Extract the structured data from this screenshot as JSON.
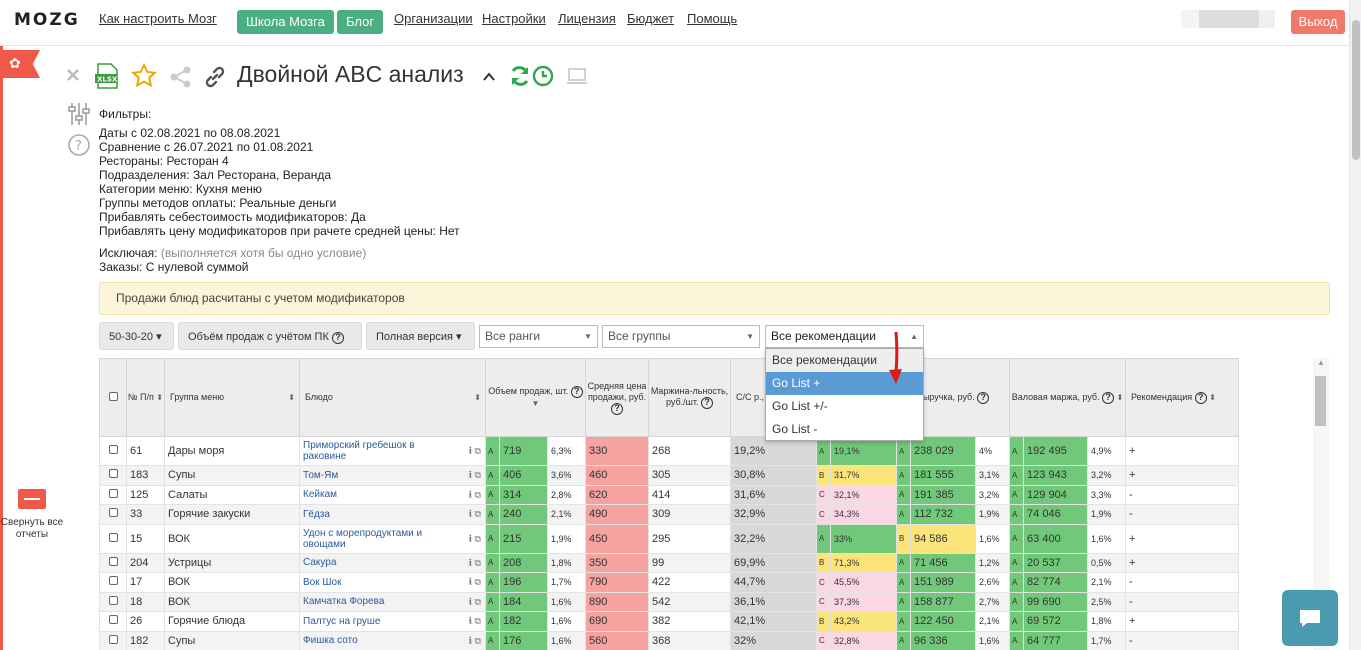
{
  "header": {
    "logo": "MOZG",
    "nav_links": {
      "howto": "Как настроить Мозг",
      "school": "Школа Мозга",
      "blog": "Блог",
      "orgs": "Организации",
      "settings": "Настройки",
      "license": "Лицензия",
      "budget": "Бюджет",
      "help": "Помощь"
    },
    "exit_label": "Выход"
  },
  "sidebar": {
    "collapse_label": "Свернуть все отчеты"
  },
  "report": {
    "title": "Двойной ABC анализ",
    "icons": [
      "close-icon",
      "xlsx-export-icon",
      "star-icon",
      "share-icon",
      "link-icon",
      "chevron-up-icon",
      "refresh-icon",
      "clock-icon",
      "monitor-icon"
    ]
  },
  "filters": {
    "heading": "Фильтры:",
    "lines": [
      "Даты с 02.08.2021 по 08.08.2021",
      "Сравнение с 26.07.2021 по 01.08.2021",
      "Рестораны: Ресторан 4",
      "Подразделения: Зал Ресторана, Веранда",
      "Категории меню: Кухня меню",
      "Группы методов оплаты: Реальные деньги",
      "Прибавлять себестоимость модификаторов: Да",
      "Прибавлять цену модификаторов при рачете средней цены: Нет"
    ],
    "exclude_label": "Исключая:",
    "exclude_hint": "(выполняется хотя бы одно условие)",
    "orders_line": "Заказы: С нулевой суммой"
  },
  "notice": "Продажи блюд расчитаны с учетом модификаторов",
  "toolbar": {
    "ratio": "50-30-20",
    "volume": "Объём продаж с учётом ПК",
    "version": "Полная версия",
    "ranks_placeholder": "Все ранги",
    "groups_placeholder": "Все группы",
    "recommend_value": "Все рекомендации"
  },
  "dropdown": {
    "options": [
      "Все рекомендации",
      "Go List +",
      "Go List +/-",
      "Go List -"
    ],
    "highlighted_index": 1
  },
  "table": {
    "headers": {
      "num": "№ П/п",
      "group": "Группа меню",
      "dish": "Блюдо",
      "volume": "Объем продаж, шт.",
      "avgprice": "Средняя цена продажи, руб.",
      "margin": "Маржина-льность, руб./шт.",
      "cc": "С/С р., %",
      "revenue": "Выручка, руб.",
      "grossmargin": "Валовая маржа, руб.",
      "recommendation": "Рекомендация"
    },
    "rows": [
      {
        "n": "61",
        "group": "Дары моря",
        "dish": "Приморский гребешок в раковине",
        "vr": "A",
        "vol": "719",
        "vp": "6,3%",
        "price": "330",
        "margin": "268",
        "cc": "19,2%",
        "cr": "A",
        "ccp": "19,1%",
        "rr": "A",
        "rev": "238 029",
        "revp": "4%",
        "mr": "A",
        "gm": "192 495",
        "gmp": "4,9%",
        "rec": "+"
      },
      {
        "n": "183",
        "group": "Супы",
        "dish": "Том-Ям",
        "vr": "A",
        "vol": "406",
        "vp": "3,6%",
        "price": "460",
        "margin": "305",
        "cc": "30,8%",
        "cr": "B",
        "ccp": "31,7%",
        "rr": "A",
        "rev": "181 555",
        "revp": "3,1%",
        "mr": "A",
        "gm": "123 943",
        "gmp": "3,2%",
        "rec": "+"
      },
      {
        "n": "125",
        "group": "Салаты",
        "dish": "Кейкам",
        "vr": "A",
        "vol": "314",
        "vp": "2,8%",
        "price": "620",
        "margin": "414",
        "cc": "31,6%",
        "cr": "C",
        "ccp": "32,1%",
        "rr": "A",
        "rev": "191 385",
        "revp": "3,2%",
        "mr": "A",
        "gm": "129 904",
        "gmp": "3,3%",
        "rec": "-"
      },
      {
        "n": "33",
        "group": "Горячие закуски",
        "dish": "Гёдза",
        "vr": "A",
        "vol": "240",
        "vp": "2,1%",
        "price": "490",
        "margin": "309",
        "cc": "32,9%",
        "cr": "C",
        "ccp": "34,3%",
        "rr": "A",
        "rev": "112 732",
        "revp": "1,9%",
        "mr": "A",
        "gm": "74 046",
        "gmp": "1,9%",
        "rec": "-"
      },
      {
        "n": "15",
        "group": "ВОК",
        "dish": "Удон с морепродуктами и овощами",
        "vr": "A",
        "vol": "215",
        "vp": "1,9%",
        "price": "450",
        "margin": "295",
        "cc": "32,2%",
        "cr": "A",
        "ccp": "33%",
        "rr": "B",
        "rev": "94 586",
        "revp": "1,6%",
        "mr": "A",
        "gm": "63 400",
        "gmp": "1,6%",
        "rec": "+"
      },
      {
        "n": "204",
        "group": "Устрицы",
        "dish": "Сакура",
        "vr": "A",
        "vol": "208",
        "vp": "1,8%",
        "price": "350",
        "margin": "99",
        "cc": "69,9%",
        "cr": "B",
        "ccp": "71,3%",
        "rr": "A",
        "rev": "71 456",
        "revp": "1,2%",
        "mr": "A",
        "gm": "20 537",
        "gmp": "0,5%",
        "rec": "+"
      },
      {
        "n": "17",
        "group": "ВОК",
        "dish": "Вок Шок",
        "vr": "A",
        "vol": "196",
        "vp": "1,7%",
        "price": "790",
        "margin": "422",
        "cc": "44,7%",
        "cr": "C",
        "ccp": "45,5%",
        "rr": "A",
        "rev": "151 989",
        "revp": "2,6%",
        "mr": "A",
        "gm": "82 774",
        "gmp": "2,1%",
        "rec": "-"
      },
      {
        "n": "18",
        "group": "ВОК",
        "dish": "Камчатка Форева",
        "vr": "A",
        "vol": "184",
        "vp": "1,6%",
        "price": "890",
        "margin": "542",
        "cc": "36,1%",
        "cr": "C",
        "ccp": "37,3%",
        "rr": "A",
        "rev": "158 877",
        "revp": "2,7%",
        "mr": "A",
        "gm": "99 690",
        "gmp": "2,5%",
        "rec": "-"
      },
      {
        "n": "26",
        "group": "Горячие блюда",
        "dish": "Палтус на груше",
        "vr": "A",
        "vol": "182",
        "vp": "1,6%",
        "price": "690",
        "margin": "382",
        "cc": "42,1%",
        "cr": "B",
        "ccp": "43,2%",
        "rr": "A",
        "rev": "122 450",
        "revp": "2,1%",
        "mr": "A",
        "gm": "69 572",
        "gmp": "1,8%",
        "rec": "+"
      },
      {
        "n": "182",
        "group": "Супы",
        "dish": "Фишка сото",
        "vr": "A",
        "vol": "176",
        "vp": "1,6%",
        "price": "560",
        "margin": "368",
        "cc": "32%",
        "cr": "C",
        "ccp": "32,8%",
        "rr": "A",
        "rev": "96 336",
        "revp": "1,6%",
        "mr": "A",
        "gm": "64 777",
        "gmp": "1,7%",
        "rec": "-"
      }
    ]
  },
  "colors": {
    "accent_green": "#4caf82",
    "exit_red": "#ef7a6c",
    "rank_green": "#72c87a",
    "rank_yellow": "#fbe47a",
    "rank_pink": "#fbd7e3",
    "price_red": "#f5a3a0",
    "chat_blue": "#4a9ab0",
    "dropdown_highlight": "#5b9bd5"
  }
}
